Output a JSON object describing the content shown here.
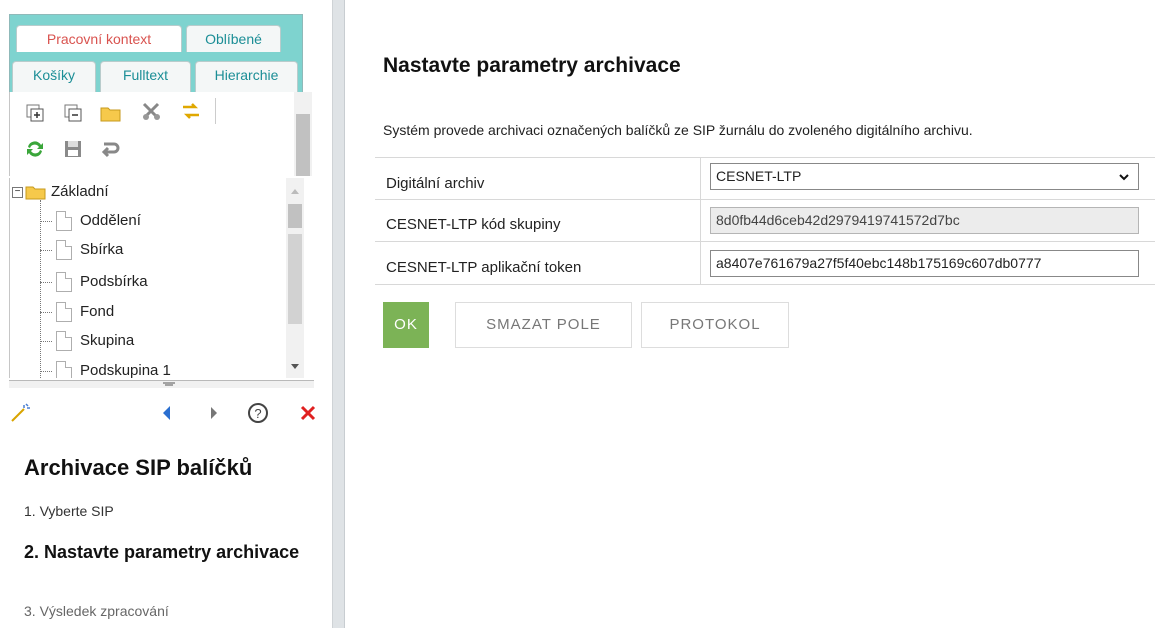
{
  "tabs": {
    "row1": [
      "Pracovní kontext",
      "Oblíbené"
    ],
    "row2": [
      "Košíky",
      "Fulltext",
      "Hierarchie"
    ]
  },
  "toolbar": {
    "icons": [
      "expand-all-icon",
      "collapse-all-icon",
      "folder-icon",
      "cut-icon",
      "move-icon",
      "refresh-icon",
      "save-icon",
      "undo-icon"
    ]
  },
  "tree": {
    "root": "Základní",
    "items": [
      "Oddělení",
      "Sbírka",
      "Podsbírka",
      "Fond",
      "Skupina",
      "Podskupina 1"
    ]
  },
  "help": {
    "title": "Archivace SIP balíčků",
    "steps": [
      "1. Vyberte SIP",
      "2. Nastavte parametry archivace",
      "3. Výsledek zpracování"
    ]
  },
  "main": {
    "title": "Nastavte parametry archivace",
    "description": "Systém provede archivaci označených balíčků ze SIP žurnálu do zvoleného digitálního archivu.",
    "fields": [
      {
        "label": "Digitální archiv",
        "value": "CESNET-LTP"
      },
      {
        "label": "CESNET-LTP kód skupiny",
        "value": "8d0fb44d6ceb42d2979419741572d7bc"
      },
      {
        "label": "CESNET-LTP aplikační token",
        "value": "a8407e761679a27f5f40ebc148b175169c607db0777"
      }
    ],
    "buttons": {
      "ok": "OK",
      "clear": "SMAZAT POLE",
      "protocol": "PROTOKOL"
    }
  },
  "colors": {
    "accent_teal": "#7ed3cf",
    "ok_green": "#7cb356",
    "close_red": "#e02020",
    "nav_blue": "#2a6fd0"
  }
}
